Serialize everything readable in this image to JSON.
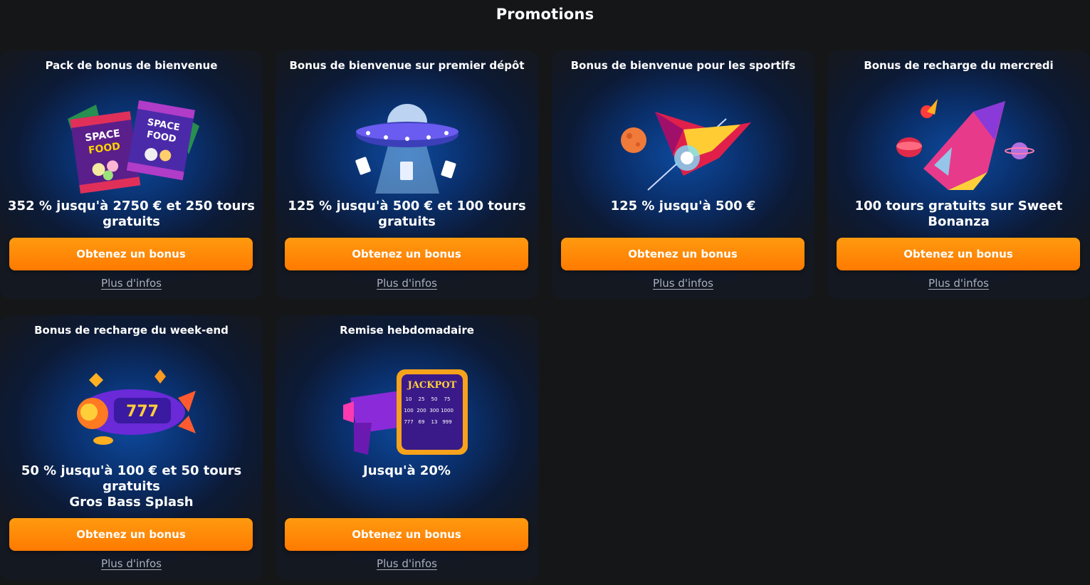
{
  "page": {
    "title": "Promotions"
  },
  "cards": [
    {
      "title": "Pack de bonus de bienvenue",
      "offer": [
        "352 % jusqu'à 2750 € et 250 tours",
        "gratuits"
      ],
      "button": "Obtenez un bonus",
      "more": "Plus d'infos",
      "image_text": [
        "SPACE",
        "FOOD",
        "SPACE",
        "FOOD"
      ]
    },
    {
      "title": "Bonus de bienvenue sur premier dépôt",
      "offer": [
        "125 % jusqu'à 500 € et 100 tours",
        "gratuits"
      ],
      "button": "Obtenez un bonus",
      "more": "Plus d'infos",
      "image_text": []
    },
    {
      "title": "Bonus de bienvenue pour les sportifs",
      "offer": [
        "125 % jusqu'à 500 €"
      ],
      "button": "Obtenez un bonus",
      "more": "Plus d'infos",
      "image_text": []
    },
    {
      "title": "Bonus de recharge du mercredi",
      "offer": [
        "100 tours gratuits sur Sweet Bonanza"
      ],
      "button": "Obtenez un bonus",
      "more": "Plus d'infos",
      "image_text": []
    },
    {
      "title": "Bonus de recharge du week-end",
      "offer": [
        "50 % jusqu'à 100 € et 50 tours",
        "gratuits",
        "Gros Bass Splash"
      ],
      "button": "Obtenez un bonus",
      "more": "Plus d'infos",
      "image_text": [
        "777"
      ]
    },
    {
      "title": "Remise hebdomadaire",
      "offer": [
        "Jusqu'à 20%"
      ],
      "button": "Obtenez un bonus",
      "more": "Plus d'infos",
      "image_text": [
        "JACKPOT",
        "10",
        "25",
        "50",
        "75",
        "100",
        "200",
        "300",
        "1000",
        "777",
        "69",
        "13",
        "999"
      ]
    }
  ],
  "colors": {
    "page_background": "#151618",
    "button_orange": "#ff8a00",
    "link_gray": "#a9afbd",
    "card_glow_blue": "#0d4a9e"
  },
  "icons": [
    "space-food-bags-icon",
    "ufo-cards-icon",
    "rocket-planet-icon",
    "spaceship-chips-icon",
    "slot-rocket-icon",
    "jackpot-blaster-icon"
  ]
}
